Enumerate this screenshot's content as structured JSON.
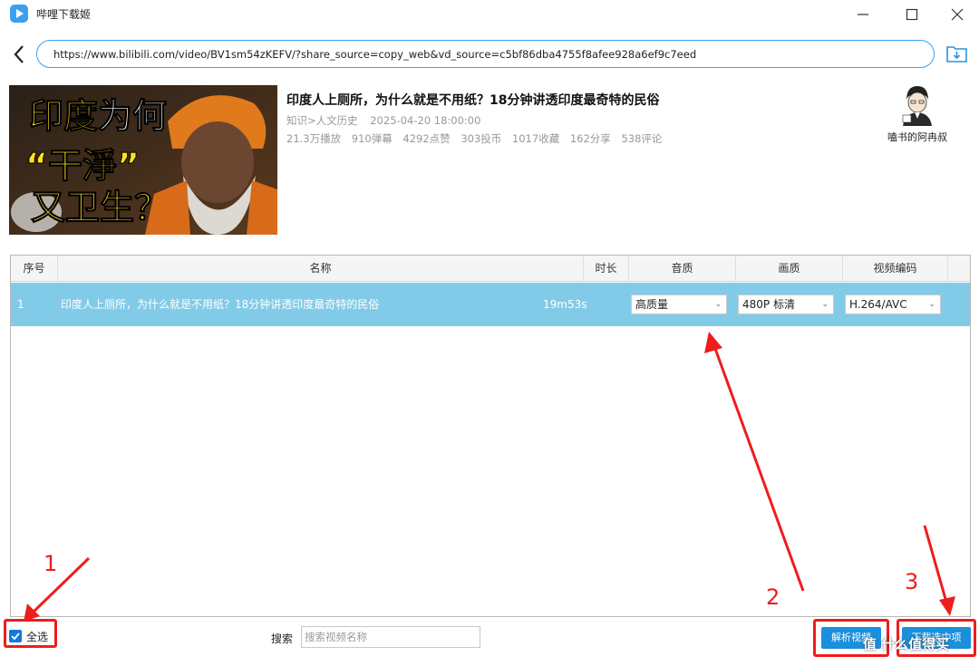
{
  "window": {
    "app_title": "哔哩下载姬",
    "logo_icon": "app-play-logo-icon",
    "controls": [
      "minimize-icon",
      "maximize-icon",
      "close-icon"
    ]
  },
  "address_bar": {
    "url": "https://www.bilibili.com/video/BV1sm54zKEFV/?share_source=copy_web&vd_source=c5bf86dba4755f8afee928a6ef9c7eed"
  },
  "video": {
    "thumbnail_text_line1_a": "印度",
    "thumbnail_text_line1_b": "为何",
    "thumbnail_text_line2": "“干淨”",
    "thumbnail_text_line3": "又卫生？",
    "title": "印度人上厕所，为什么就是不用纸？18分钟讲透印度最奇特的民俗",
    "category": "知识>人文历史",
    "publish_time": "2025-04-20 18:00:00",
    "stats": [
      "21.3万播放",
      "910弹幕",
      "4292点赞",
      "303投币",
      "1017收藏",
      "162分享",
      "538评论"
    ],
    "uploader": "嗑书的阿冉叔"
  },
  "table": {
    "headers": [
      "序号",
      "名称",
      "时长",
      "音质",
      "画质",
      "视频编码"
    ],
    "rows": [
      {
        "index": "1",
        "name": "印度人上厕所，为什么就是不用纸？18分钟讲透印度最奇特的民俗",
        "duration": "19m53s",
        "audio": "高质量",
        "quality": "480P 标清",
        "codec": "H.264/AVC"
      }
    ]
  },
  "bottom": {
    "select_all_label": "全选",
    "select_all_checked": true,
    "search_label": "搜索",
    "search_placeholder": "搜索视频名称",
    "parse_button": "解析视频",
    "download_button": "下载选中项"
  },
  "annotations": {
    "step1": "1",
    "step2": "2",
    "step3": "3",
    "color": "#ee1d1d"
  },
  "watermark": "值 什么值得买"
}
